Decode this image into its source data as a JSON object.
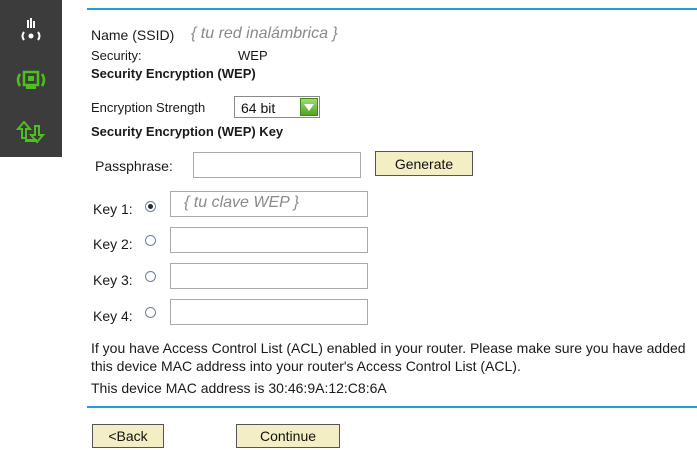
{
  "sidebar": {
    "icons": [
      "wifi-router-icon",
      "wireless-adapter-icon",
      "transfer-arrows-icon"
    ]
  },
  "form": {
    "ssid_label": "Name (SSID)",
    "ssid_value": "{ tu red inalámbrica }",
    "security_label": "Security:",
    "security_value": "WEP",
    "section_encryption": "Security Encryption (WEP)",
    "strength_label": "Encryption Strength",
    "strength_value": "64 bit",
    "section_key": "Security Encryption (WEP) Key",
    "passphrase_label": "Passphrase:",
    "passphrase_value": "",
    "generate_label": "Generate",
    "keys": [
      {
        "label": "Key 1:",
        "value": "{ tu clave WEP }",
        "selected": true
      },
      {
        "label": "Key 2:",
        "value": "",
        "selected": false
      },
      {
        "label": "Key 3:",
        "value": "",
        "selected": false
      },
      {
        "label": "Key 4:",
        "value": "",
        "selected": false
      }
    ],
    "acl_note": "If you have Access Control List (ACL) enabled in your router. Please make sure you have added this device MAC address into your router's Access Control List (ACL).",
    "mac_note": "This device MAC address is 30:46:9A:12:C8:6A",
    "back_label": "<Back",
    "continue_label": "Continue"
  },
  "colors": {
    "sidebar": "#3c3c3c",
    "icon_green": "#4fbf1f",
    "rule": "#1ea1d6",
    "button": "#f4eec4"
  }
}
